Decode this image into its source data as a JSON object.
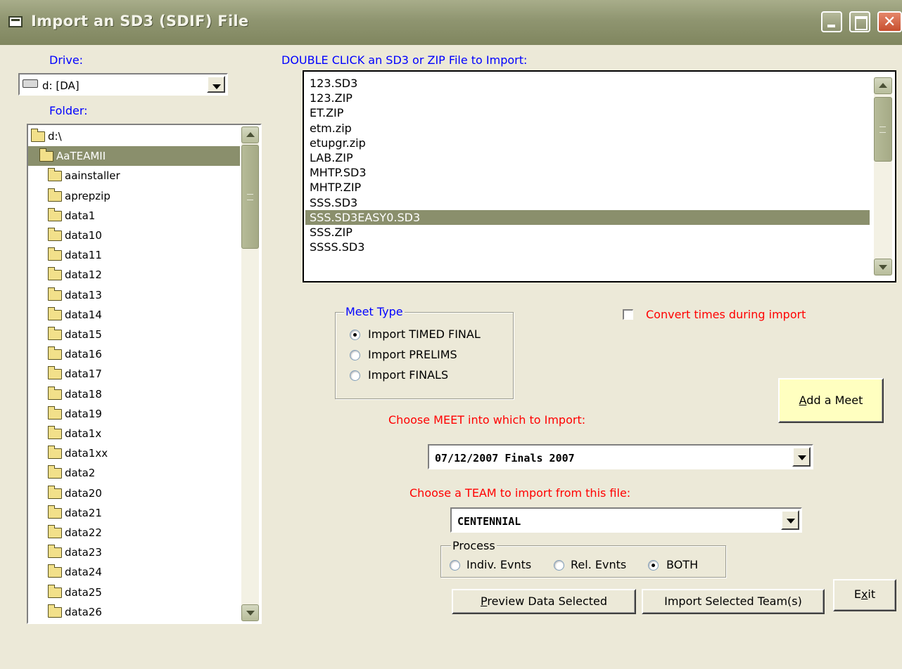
{
  "window": {
    "title": "Import an SD3 (SDIF) File"
  },
  "drive": {
    "label": "Drive:",
    "value": "d: [DA]"
  },
  "folder": {
    "label": "Folder:",
    "items": [
      "d:\\",
      "AaTEAMII",
      "aainstaller",
      "aprepzip",
      "data1",
      "data10",
      "data11",
      "data12",
      "data13",
      "data14",
      "data15",
      "data16",
      "data17",
      "data18",
      "data19",
      "data1x",
      "data1xx",
      "data2",
      "data20",
      "data21",
      "data22",
      "data23",
      "data24",
      "data25",
      "data26"
    ],
    "selected": "AaTEAMII"
  },
  "files": {
    "label": "DOUBLE CLICK an  SD3 or ZIP  File to Import:",
    "items": [
      "123.SD3",
      "123.ZIP",
      "ET.ZIP",
      "etm.zip",
      "etupgr.zip",
      "LAB.ZIP",
      "MHTP.SD3",
      "MHTP.ZIP",
      "SSS.SD3",
      "SSS.SD3EASY0.SD3",
      "SSS.ZIP",
      "SSSS.SD3"
    ],
    "selected": "SSS.SD3EASY0.SD3"
  },
  "meet_type": {
    "title": "Meet Type",
    "options": [
      "Import TIMED FINAL",
      "Import PRELIMS",
      "Import  FINALS"
    ],
    "selected": "Import TIMED FINAL"
  },
  "convert_times": {
    "label": "Convert times during import",
    "checked": false
  },
  "add_meet": {
    "label": "Add a Meet",
    "accel": "A",
    "rest": "dd a Meet"
  },
  "meet_select": {
    "label": "Choose MEET into which to Import:",
    "value": "07/12/2007 Finals 2007"
  },
  "team_select": {
    "label": "Choose a TEAM to import from this file:",
    "value": "CENTENNIAL"
  },
  "process": {
    "title": "Process",
    "options": [
      "Indiv. Evnts",
      "Rel. Evnts",
      "BOTH"
    ],
    "selected": "BOTH"
  },
  "buttons": {
    "preview": {
      "accel": "P",
      "rest": "review Data Selected"
    },
    "import": "Import Selected Team(s)",
    "exit": {
      "pre": "E",
      "accel": "x",
      "post": "it"
    }
  }
}
